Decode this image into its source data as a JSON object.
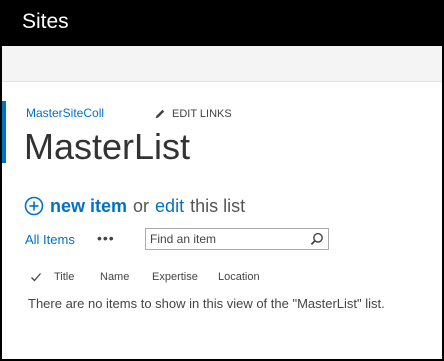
{
  "suitebar": {
    "title": "Sites"
  },
  "breadcrumb": {
    "site_link": "MasterSiteColl",
    "edit_links": "EDIT LINKS"
  },
  "page": {
    "title": "MasterList"
  },
  "actions": {
    "new_item": "new item",
    "or": "or",
    "edit": "edit",
    "this_list": "this list"
  },
  "view_bar": {
    "view_name": "All Items",
    "more": "•••",
    "search_placeholder": "Find an item"
  },
  "columns": [
    "Title",
    "Name",
    "Expertise",
    "Location"
  ],
  "empty_message": "There are no items to show in this view of the \"MasterList\" list.",
  "colors": {
    "accent": "#0072c6",
    "suitebar": "#000000"
  },
  "icons": {
    "edit": "pencil-icon",
    "new": "plus-circle-icon",
    "search": "search-icon",
    "select": "checkmark-icon"
  }
}
